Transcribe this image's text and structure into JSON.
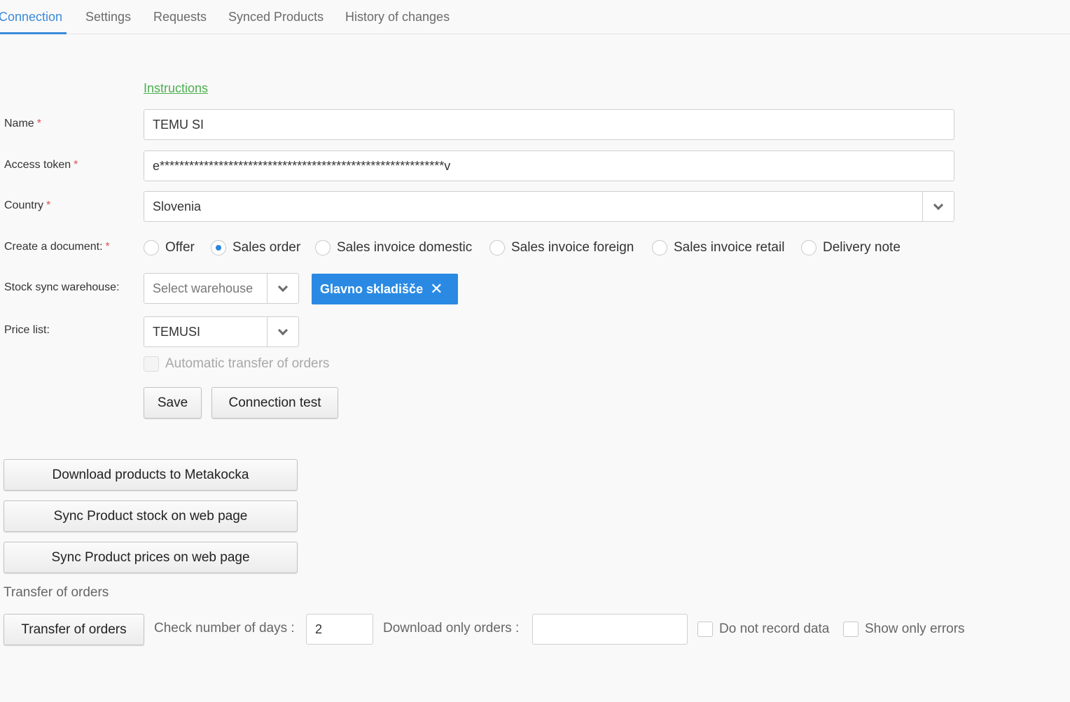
{
  "tabs": [
    {
      "label": "Connection",
      "active": true
    },
    {
      "label": "Settings"
    },
    {
      "label": "Requests"
    },
    {
      "label": "Synced Products"
    },
    {
      "label": "History of changes"
    }
  ],
  "form": {
    "instructions_link": "Instructions",
    "name": {
      "label": "Name",
      "required_mark": "*",
      "value": "TEMU SI"
    },
    "access_token": {
      "label": "Access token",
      "required_mark": "*",
      "value": "e**********************************************************v"
    },
    "country": {
      "label": "Country",
      "required_mark": "*",
      "value": "Slovenia"
    },
    "create_document": {
      "label": "Create a document:",
      "required_mark": "*",
      "options": [
        "Offer",
        "Sales order",
        "Sales invoice domestic",
        "Sales invoice foreign",
        "Sales invoice retail",
        "Delivery note"
      ],
      "selected": "Sales order"
    },
    "stock_sync_warehouse": {
      "label": "Stock sync warehouse:",
      "placeholder": "Select warehouse",
      "selected_tag": "Glavno skladišče"
    },
    "price_list": {
      "label": "Price list:",
      "value": "TEMUSI"
    },
    "automatic_transfer": {
      "label": "Automatic transfer of orders",
      "checked": false,
      "disabled": true
    },
    "save_label": "Save",
    "connection_test_label": "Connection test"
  },
  "actions": {
    "download_products": "Download products to Metakocka",
    "sync_stock": "Sync Product stock on web page",
    "sync_prices": "Sync Product prices on web page"
  },
  "transfer": {
    "section_title": "Transfer of orders",
    "button_label": "Transfer of orders",
    "days_label": "Check number of days :",
    "days_value": "2",
    "download_only_label": "Download only orders :",
    "download_only_value": "",
    "do_not_record_label": "Do not record data",
    "show_only_errors_label": "Show only errors"
  },
  "colors": {
    "accent": "#2a8ae3",
    "link": "#4caf50",
    "required": "#d9534f"
  }
}
